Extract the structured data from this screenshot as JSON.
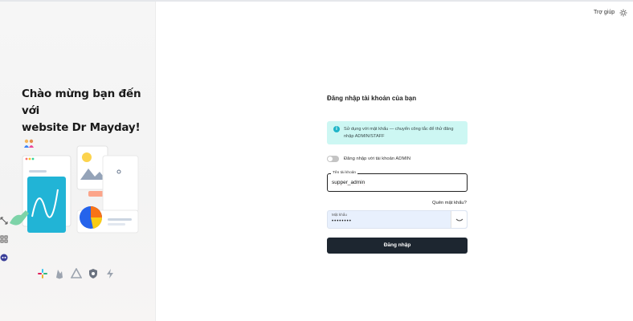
{
  "left": {
    "welcome_line1": "Chào mừng bạn đến với",
    "welcome_line2": "website Dr Mayday!",
    "logos": [
      "slack-logo",
      "firebase-logo",
      "prisma-logo",
      "aws-logo",
      "supabase-logo"
    ],
    "side_tools": [
      "expand-icon",
      "grid-icon",
      "robot-icon"
    ]
  },
  "header": {
    "help_label": "Trợ giúp"
  },
  "form": {
    "title": "Đăng nhập tài khoản của bạn",
    "info_text": "Sử dụng với mật khẩu — chuyển công tắc để thử đăng nhập ADMIN/STAFF",
    "toggle_label": "Đăng nhập với tài khoản ADMIN",
    "username_label": "Tên tài khoản",
    "username_value": "supper_admin",
    "forgot_label": "Quên mật khẩu?",
    "password_label": "Mật khẩu",
    "password_value": "••••••••",
    "submit_label": "Đăng nhập"
  },
  "colors": {
    "info_bg": "#cdf7f3",
    "info_icon": "#1fb5c8",
    "button_bg": "#1d2630",
    "password_bg": "#e8f0fd"
  }
}
